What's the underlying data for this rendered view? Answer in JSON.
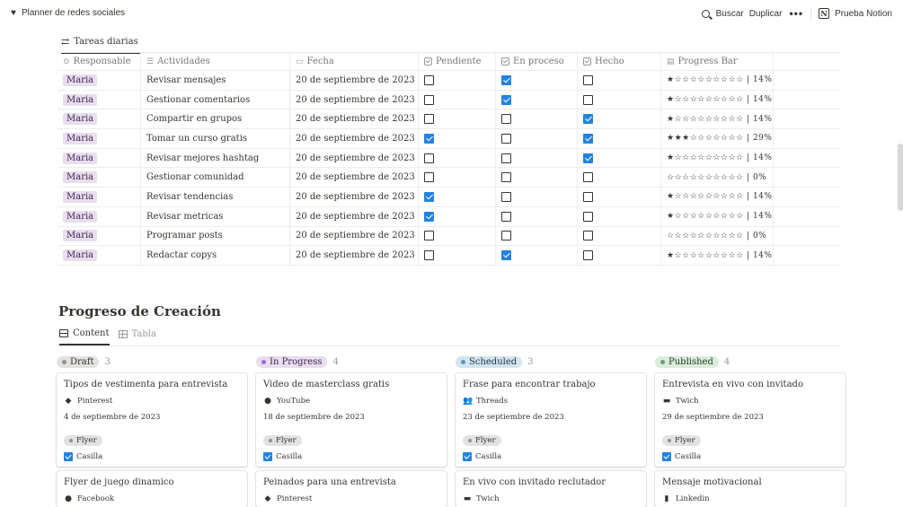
{
  "topbar": {
    "page_title": "Planner de redes sociales",
    "search_label": "Buscar",
    "duplicate_label": "Duplicar",
    "more_label": "•••",
    "notion_logo": "N",
    "notion_label": "Prueba Notion"
  },
  "daily": {
    "tab_label": "Tareas diarias",
    "columns": {
      "responsable": "Responsable",
      "actividades": "Actividades",
      "fecha": "Fecha",
      "pendiente": "Pendiente",
      "en_proceso": "En proceso",
      "hecho": "Hecho",
      "progress": "Progress Bar"
    },
    "rows": [
      {
        "responsable": "Maria",
        "actividad": "Revisar mensajes",
        "fecha": "20 de septiembre de 2023",
        "pendiente": false,
        "en_proceso": true,
        "hecho": false,
        "progress": "★☆☆☆☆☆☆☆☆☆ | 14%"
      },
      {
        "responsable": "Maria",
        "actividad": "Gestionar comentarios",
        "fecha": "20 de septiembre de 2023",
        "pendiente": false,
        "en_proceso": true,
        "hecho": false,
        "progress": "★☆☆☆☆☆☆☆☆☆ | 14%"
      },
      {
        "responsable": "Maria",
        "actividad": "Compartir en grupos",
        "fecha": "20 de septiembre de 2023",
        "pendiente": false,
        "en_proceso": false,
        "hecho": true,
        "progress": "★☆☆☆☆☆☆☆☆☆ | 14%"
      },
      {
        "responsable": "Maria",
        "actividad": "Tomar un curso gratis",
        "fecha": "20 de septiembre de 2023",
        "pendiente": true,
        "en_proceso": false,
        "hecho": true,
        "progress": "★★★☆☆☆☆☆☆☆ | 29%"
      },
      {
        "responsable": "Maria",
        "actividad": "Revisar mejores hashtag",
        "fecha": "20 de septiembre de 2023",
        "pendiente": false,
        "en_proceso": false,
        "hecho": true,
        "progress": "★☆☆☆☆☆☆☆☆☆ | 14%"
      },
      {
        "responsable": "Maria",
        "actividad": "Gestionar comunidad",
        "fecha": "20 de septiembre de 2023",
        "pendiente": false,
        "en_proceso": false,
        "hecho": false,
        "progress": "☆☆☆☆☆☆☆☆☆☆ | 0%"
      },
      {
        "responsable": "Maria",
        "actividad": "Revisar tendencias",
        "fecha": "20 de septiembre de 2023",
        "pendiente": true,
        "en_proceso": false,
        "hecho": false,
        "progress": "★☆☆☆☆☆☆☆☆☆ | 14%"
      },
      {
        "responsable": "Maria",
        "actividad": "Revisar metricas",
        "fecha": "20 de septiembre de 2023",
        "pendiente": true,
        "en_proceso": false,
        "hecho": false,
        "progress": "★☆☆☆☆☆☆☆☆☆ | 14%"
      },
      {
        "responsable": "Maria",
        "actividad": "Programar posts",
        "fecha": "20 de septiembre de 2023",
        "pendiente": false,
        "en_proceso": false,
        "hecho": false,
        "progress": "☆☆☆☆☆☆☆☆☆☆ | 0%"
      },
      {
        "responsable": "Maria",
        "actividad": "Redactar copys",
        "fecha": "20 de septiembre de 2023",
        "pendiente": false,
        "en_proceso": true,
        "hecho": false,
        "progress": "★☆☆☆☆☆☆☆☆☆ | 14%"
      }
    ]
  },
  "creation": {
    "title": "Progreso de Creación",
    "tabs": [
      {
        "label": "Content",
        "active": true,
        "icon": "board-icon"
      },
      {
        "label": "Tabla",
        "active": false,
        "icon": "table-icon"
      }
    ],
    "columns": [
      {
        "status": "Draft",
        "count": "3",
        "pill_bg": "#e3e2e0",
        "dot": "#91918e",
        "text": "#32302c",
        "cards": [
          {
            "title": "Tipos de vestimenta para entrevista",
            "platform": "Pinterest",
            "platform_icon": "diamond-icon",
            "platform_glyph": "◆",
            "date": "4 de septiembre de 2023",
            "tag": "Flyer",
            "check": "Casilla"
          },
          {
            "title": "Flyer de juego dinamico",
            "platform": "Facebook",
            "platform_icon": "facebook-icon",
            "platform_glyph": "●"
          }
        ]
      },
      {
        "status": "In Progress",
        "count": "4",
        "pill_bg": "#e8deee",
        "dot": "#9a6dd7",
        "text": "#412454",
        "cards": [
          {
            "title": "Video de masterclass gratis",
            "platform": "YouTube",
            "platform_icon": "youtube-icon",
            "platform_glyph": "●",
            "date": "18 de septiembre de 2023",
            "tag": "Flyer",
            "check": "Casilla"
          },
          {
            "title": "Peinados para una entrevista",
            "platform": "Pinterest",
            "platform_icon": "diamond-icon",
            "platform_glyph": "◆"
          }
        ]
      },
      {
        "status": "Scheduled",
        "count": "3",
        "pill_bg": "#d3e5ef",
        "dot": "#5b97bd",
        "text": "#183347",
        "cards": [
          {
            "title": "Frase para encontrar trabajo",
            "platform": "Threads",
            "platform_icon": "people-icon",
            "platform_glyph": "👥",
            "date": "23 de septiembre de 2023",
            "tag": "Flyer",
            "check": "Casilla"
          },
          {
            "title": "En vivo con invitado reclutador",
            "platform": "Twich",
            "platform_icon": "monitor-icon",
            "platform_glyph": "▬"
          }
        ]
      },
      {
        "status": "Published",
        "count": "4",
        "pill_bg": "#dbeddb",
        "dot": "#6c9b7d",
        "text": "#1c3829",
        "cards": [
          {
            "title": "Entrevista en vivo con invitado",
            "platform": "Twich",
            "platform_icon": "monitor-icon",
            "platform_glyph": "▬",
            "date": "29 de septiembre de 2023",
            "tag": "Flyer",
            "check": "Casilla"
          },
          {
            "title": "Mensaje motivacional",
            "platform": "Linkedin",
            "platform_icon": "document-icon",
            "platform_glyph": "▮"
          }
        ]
      }
    ]
  }
}
